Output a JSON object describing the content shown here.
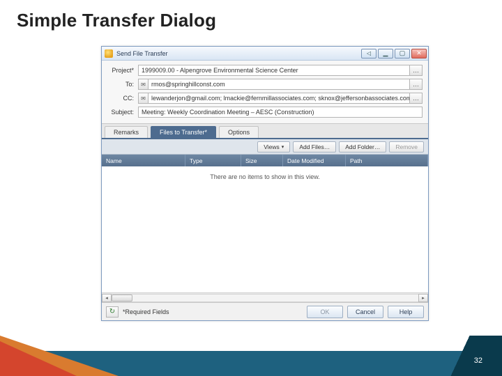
{
  "slide": {
    "title": "Simple Transfer Dialog",
    "page_number": "32"
  },
  "window": {
    "title": "Send File Transfer",
    "buttons": {
      "prev": "◁",
      "min": "▁",
      "max": "▢",
      "close": "✕"
    }
  },
  "form": {
    "project_label": "Project*",
    "project_value": "1999009.00 - Alpengrove Environmental Science Center",
    "to_label": "To:",
    "to_value": "rmos@springhillconst.com",
    "cc_label": "CC:",
    "cc_value": "lewanderjon@gmail.com; lmackie@fernmillassociates.com; sknox@jeffersonbassociates.com",
    "subject_label": "Subject:",
    "subject_value": "Meeting: Weekly Coordination Meeting – AESC (Construction)"
  },
  "tabs": {
    "remarks": "Remarks",
    "files": "Files to Transfer*",
    "options": "Options"
  },
  "toolbar": {
    "views": "Views",
    "add_files": "Add Files…",
    "add_folder": "Add Folder…",
    "remove": "Remove"
  },
  "columns": {
    "name": "Name",
    "type": "Type",
    "size": "Size",
    "date_modified": "Date Modified",
    "path": "Path"
  },
  "list": {
    "empty_message": "There are no items to show in this view."
  },
  "footer": {
    "required_note": "*Required Fields",
    "ok": "OK",
    "cancel": "Cancel",
    "help": "Help"
  }
}
